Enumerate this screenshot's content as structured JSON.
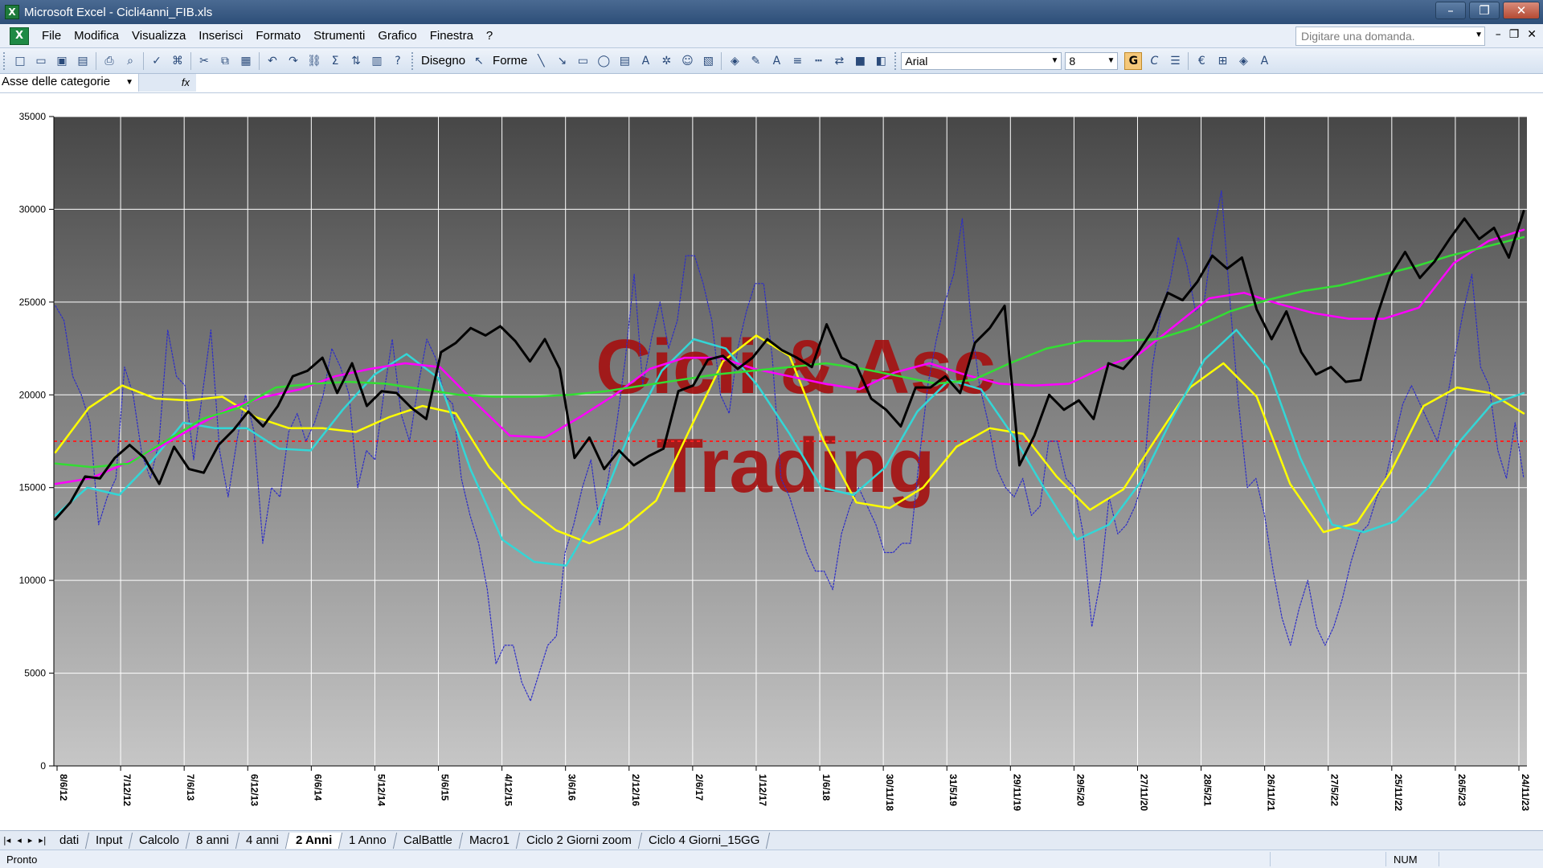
{
  "window": {
    "title": "Microsoft Excel - Cicli4anni_FIB.xls"
  },
  "menubar": {
    "items": [
      "File",
      "Modifica",
      "Visualizza",
      "Inserisci",
      "Formato",
      "Strumenti",
      "Grafico",
      "Finestra",
      "?"
    ],
    "ask_placeholder": "Digitare una domanda."
  },
  "toolbar": {
    "draw_label": "Disegno",
    "shapes_label": "Forme",
    "font_name": "Arial",
    "font_size": "8",
    "bold": "G",
    "italic": "C"
  },
  "formula": {
    "name_box": "Asse delle categorie",
    "fx": "fx"
  },
  "chart_data": {
    "type": "line",
    "watermark": [
      "Cicli & Asc",
      "Trading"
    ],
    "ylim": [
      0,
      35000
    ],
    "y_ticks": [
      0,
      5000,
      10000,
      15000,
      20000,
      25000,
      30000,
      35000
    ],
    "x_tick_labels": [
      "8/6/12",
      "7/12/12",
      "7/6/13",
      "6/12/13",
      "6/6/14",
      "5/12/14",
      "5/6/15",
      "4/12/15",
      "3/6/16",
      "2/12/16",
      "2/6/17",
      "1/12/17",
      "1/6/18",
      "30/11/18",
      "31/5/19",
      "29/11/19",
      "29/5/20",
      "27/11/20",
      "28/5/21",
      "26/11/21",
      "27/5/22",
      "25/11/22",
      "26/5/23",
      "24/11/23"
    ],
    "reference_line": 17500,
    "series": [
      {
        "color": "#000000",
        "style": "thick",
        "values": [
          13300,
          14200,
          15600,
          15500,
          16600,
          17300,
          16600,
          15200,
          17200,
          16000,
          15800,
          17300,
          18100,
          19100,
          18300,
          19400,
          21000,
          21300,
          22000,
          20100,
          21700,
          19400,
          20200,
          20100,
          19300,
          18700,
          22300,
          22800,
          23600,
          23200,
          23700,
          22900,
          21800,
          23000,
          21400,
          16600,
          17700,
          16000,
          17000,
          16200,
          16700,
          17100,
          20200,
          20500,
          21900,
          22100,
          21400,
          22000,
          23000,
          22400,
          22000,
          21500,
          23800,
          22000,
          21600,
          19800,
          19200,
          18300,
          20400,
          20400,
          21000,
          20100,
          22800,
          23600,
          24800,
          16200,
          17800,
          20000,
          19200,
          19700,
          18700,
          21700,
          21400,
          22300,
          23500,
          25500,
          25100,
          26100,
          27500,
          26800,
          27400,
          24600,
          23000,
          24500,
          22300,
          21100,
          21500,
          20700,
          20800,
          24000,
          26400,
          27700,
          26300,
          27200,
          28400,
          29500,
          28400,
          29000,
          27400,
          29900
        ]
      },
      {
        "color": "#2d2dc8",
        "style": "dotted",
        "values": [
          24800,
          24000,
          21000,
          20000,
          18500,
          13000,
          14500,
          15500,
          21500,
          20000,
          16800,
          15500,
          17500,
          23500,
          21000,
          20500,
          16500,
          20000,
          23500,
          17000,
          14500,
          17500,
          20000,
          18000,
          12000,
          15000,
          14500,
          18000,
          19000,
          17500,
          18500,
          20000,
          22500,
          21500,
          20000,
          15000,
          17000,
          16500,
          20000,
          23000,
          19000,
          17500,
          20500,
          23000,
          22000,
          20000,
          19500,
          15500,
          13500,
          12000,
          9500,
          5500,
          6500,
          6500,
          4500,
          3500,
          5000,
          6500,
          7000,
          11500,
          13000,
          15000,
          16500,
          13000,
          15500,
          18500,
          22000,
          26500,
          20500,
          23000,
          25000,
          22500,
          24000,
          27500,
          27500,
          26000,
          24000,
          20000,
          19000,
          22500,
          24500,
          26000,
          26000,
          22000,
          15500,
          14500,
          13000,
          11500,
          10500,
          10500,
          9500,
          12500,
          14000,
          15000,
          14000,
          13000,
          11500,
          11500,
          12000,
          12000,
          16500,
          20500,
          23000,
          25000,
          26500,
          29500,
          24000,
          20500,
          18500,
          16000,
          15000,
          14500,
          15500,
          13500,
          14000,
          17500,
          17500,
          15500,
          15000,
          12500,
          7500,
          10000,
          14500,
          12500,
          13000,
          14000,
          15500,
          21500,
          24500,
          26000,
          28500,
          27000,
          24500,
          25000,
          28500,
          31000,
          25000,
          19500,
          15000,
          15500,
          13500,
          10500,
          8000,
          6500,
          8500,
          10000,
          7500,
          6500,
          7500,
          9000,
          11000,
          12500,
          13000,
          14500,
          15500,
          17500,
          19500,
          20500,
          19500,
          18500,
          17500,
          19500,
          22000,
          24500,
          26500,
          21500,
          20500,
          17000,
          15500,
          18500,
          15500
        ]
      },
      {
        "color": "#ffff00",
        "style": "normal",
        "values": [
          16900,
          19300,
          20500,
          19800,
          19700,
          19900,
          18800,
          18200,
          18200,
          18000,
          18800,
          19400,
          19000,
          16100,
          14100,
          12700,
          12000,
          12800,
          14300,
          18100,
          21800,
          23200,
          22100,
          17600,
          14200,
          13900,
          15000,
          17200,
          18200,
          17900,
          15600,
          13800,
          14900,
          17700,
          20400,
          21700,
          19900,
          15200,
          12600,
          13100,
          15800,
          19400,
          20400,
          20100,
          19000
        ]
      },
      {
        "color": "#33d6d6",
        "style": "normal",
        "values": [
          13500,
          15000,
          14600,
          16400,
          18500,
          18200,
          18200,
          17100,
          17000,
          19200,
          21100,
          22200,
          20900,
          16000,
          12200,
          11000,
          10800,
          13700,
          18000,
          21300,
          23000,
          22500,
          20500,
          17900,
          15000,
          14600,
          16100,
          19100,
          20800,
          20300,
          17800,
          14900,
          12200,
          13000,
          15300,
          18800,
          21900,
          23500,
          21400,
          16600,
          13000,
          12600,
          13200,
          15000,
          17500,
          19500,
          20100
        ]
      },
      {
        "color": "#ff00ff",
        "style": "normal",
        "values": [
          15200,
          15500,
          16300,
          17200,
          18300,
          19300,
          19900,
          20300,
          21000,
          21400,
          21700,
          21500,
          19600,
          17800,
          17700,
          18800,
          20000,
          21400,
          22000,
          22000,
          21400,
          21000,
          20600,
          20300,
          21200,
          21700,
          21100,
          20600,
          20500,
          20600,
          21500,
          22200,
          23700,
          25200,
          25500,
          24900,
          24400,
          24100,
          24100,
          24700,
          27100,
          28300,
          28900
        ]
      },
      {
        "color": "#33dd33",
        "style": "normal",
        "values": [
          16300,
          16100,
          16300,
          17500,
          18700,
          19300,
          20400,
          20600,
          20700,
          20600,
          20300,
          20000,
          19900,
          19900,
          20000,
          20200,
          20500,
          20800,
          21100,
          21300,
          21500,
          21700,
          21400,
          21000,
          20600,
          20800,
          21700,
          22500,
          22900,
          22900,
          23000,
          23600,
          24500,
          25100,
          25600,
          25900,
          26400,
          26900,
          27500,
          28000,
          28500
        ]
      }
    ]
  },
  "sheet_tabs": {
    "nav": [
      "|◂",
      "◂",
      "▸",
      "▸|"
    ],
    "tabs": [
      "dati",
      "Input",
      "Calcolo",
      "8 anni",
      "4 anni",
      "2 Anni",
      "1 Anno",
      "CalBattle",
      "Macro1",
      "Ciclo 2 Giorni zoom",
      "Ciclo 4 Giorni_15GG"
    ],
    "active_index": 5
  },
  "status": {
    "text": "Pronto",
    "num": "NUM"
  }
}
